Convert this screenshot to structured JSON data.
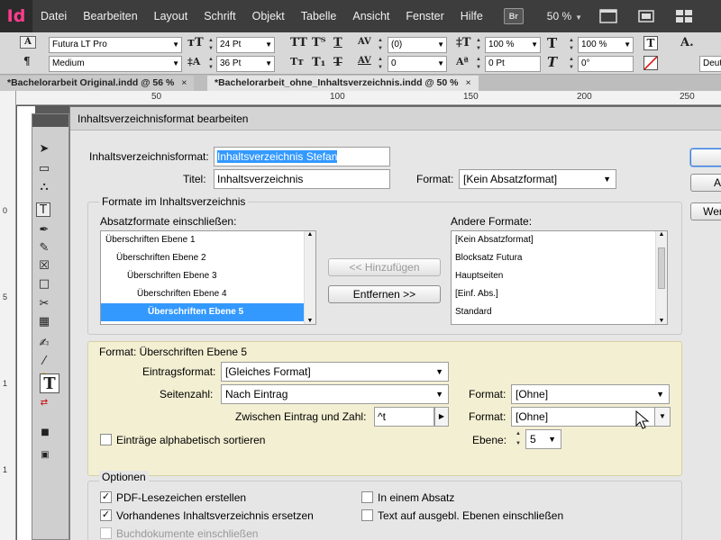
{
  "app": {
    "logo": "Id",
    "menu": [
      "Datei",
      "Bearbeiten",
      "Layout",
      "Schrift",
      "Objekt",
      "Tabelle",
      "Ansicht",
      "Fenster",
      "Hilfe"
    ],
    "bridge_label": "Br",
    "zoom": "50 %"
  },
  "controlbar": {
    "font_family": "Futura LT Pro",
    "font_style": "Medium",
    "font_size": "24 Pt",
    "leading": "36 Pt",
    "tracking": "(0)",
    "kerning": "0",
    "vertical_scale": "100 %",
    "baseline_shift": "0 Pt",
    "horizontal_scale": "100 %",
    "skew": "0°",
    "language": "Deut"
  },
  "tabs": [
    {
      "label": "*Bachelorarbeit Original.indd @ 56 %",
      "close": "×"
    },
    {
      "label": "*Bachelorarbeit_ohne_Inhaltsverzeichnis.indd @ 50 %",
      "close": "×"
    }
  ],
  "ruler": {
    "top_ticks": [
      "50",
      "100",
      "150",
      "200",
      "250"
    ],
    "left_ticks": [
      "0",
      "5",
      "1",
      "1"
    ]
  },
  "dialog": {
    "title": "Inhaltsverzeichnisformat bearbeiten",
    "toc_format_label": "Inhaltsverzeichnisformat:",
    "toc_format_value": "Inhaltsverzeichnis Stefan",
    "title_label": "Titel:",
    "title_value": "Inhaltsverzeichnis",
    "format_label": "Format:",
    "format_value": "[Kein Absatzformat]",
    "formats_group_title": "Formate im Inhaltsverzeichnis",
    "include_label": "Absatzformate einschließen:",
    "include_items": [
      "Überschriften Ebene 1",
      "Überschriften Ebene 2",
      "Überschriften Ebene 3",
      "Überschriften Ebene 4",
      "Überschriften Ebene 5"
    ],
    "add_button": "<< Hinzufügen",
    "remove_button": "Entfernen >>",
    "other_label": "Andere Formate:",
    "other_items": [
      "[Kein Absatzformat]",
      "Blocksatz Futura",
      "Hauptseiten",
      "[Einf. Abs.]",
      "Standard"
    ],
    "format_section_title": "Format: Überschriften Ebene 5",
    "entry_format_label": "Eintragsformat:",
    "entry_format_value": "[Gleiches Format]",
    "page_number_label": "Seitenzahl:",
    "page_number_value": "Nach Eintrag",
    "page_number_format_label": "Format:",
    "page_number_format_value": "[Ohne]",
    "between_label": "Zwischen Eintrag und Zahl:",
    "between_value": "^t",
    "between_format_label": "Format:",
    "between_format_value": "[Ohne]",
    "sort_label": "Einträge alphabetisch sortieren",
    "level_label": "Ebene:",
    "level_value": "5",
    "options_title": "Optionen",
    "opt_pdf_bookmarks": "PDF-Lesezeichen erstellen",
    "opt_replace_existing": "Vorhandenes Inhaltsverzeichnis ersetzen",
    "opt_book_documents": "Buchdokumente einschließen",
    "opt_one_paragraph": "In einem Absatz",
    "opt_hidden_layers": "Text auf ausgebl. Ebenen einschließen",
    "right_button_partial": "A",
    "more_button_partial": "Wer"
  }
}
